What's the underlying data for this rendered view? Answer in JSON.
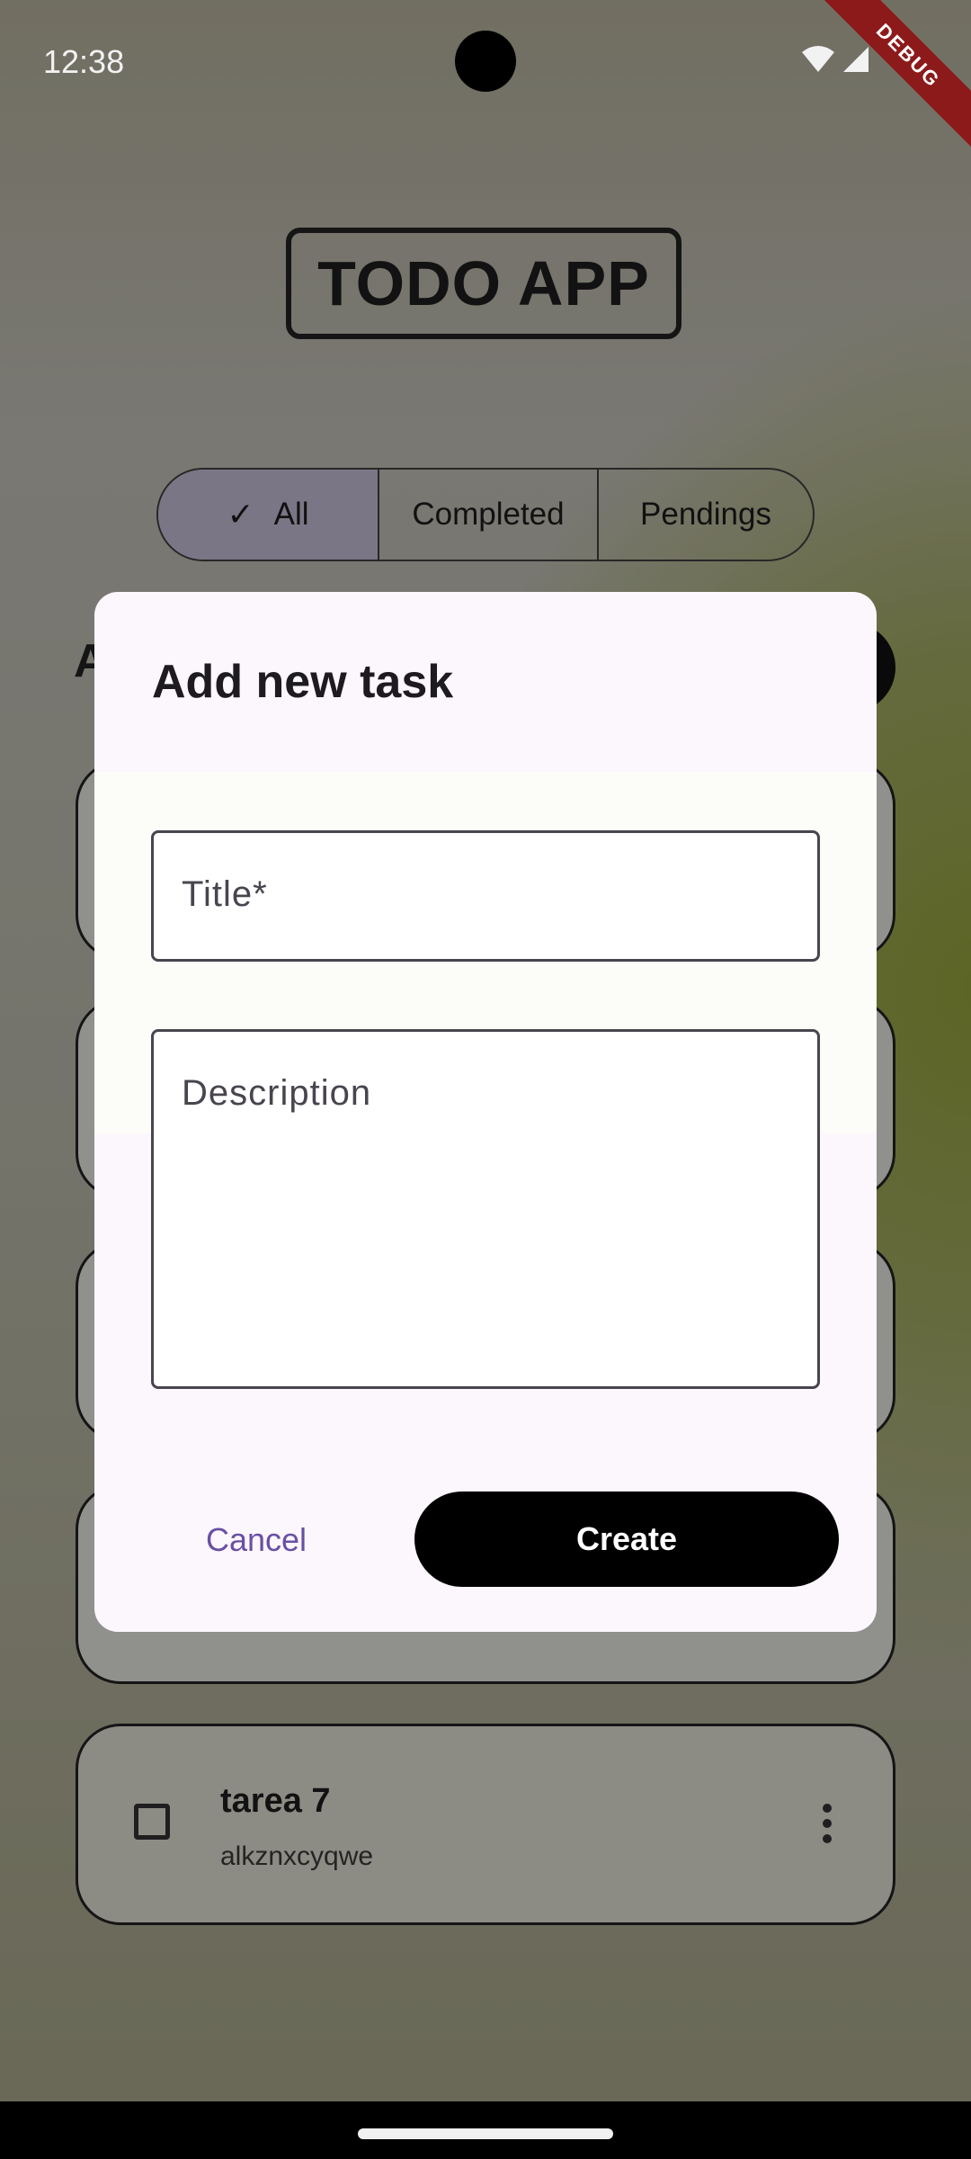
{
  "status_bar": {
    "time": "12:38",
    "debug_banner": "DEBUG"
  },
  "app": {
    "title": "TODO APP",
    "filters": [
      {
        "label": "All",
        "selected": true
      },
      {
        "label": "Completed",
        "selected": false
      },
      {
        "label": "Pendings",
        "selected": false
      }
    ],
    "list_heading_partial": "A",
    "tasks": [
      {
        "title": "tarea 7",
        "description": "alkznxcyqwe",
        "completed": false
      }
    ]
  },
  "dialog": {
    "title": "Add new task",
    "title_field": {
      "placeholder": "Title*",
      "value": ""
    },
    "description_field": {
      "placeholder": "Description",
      "value": ""
    },
    "cancel_label": "Cancel",
    "create_label": "Create"
  },
  "colors": {
    "dialog_surface": "#fcf6fd",
    "primary_text_button": "#6750a4",
    "create_button": "#000000",
    "selected_segment": "#c7bfd9"
  }
}
